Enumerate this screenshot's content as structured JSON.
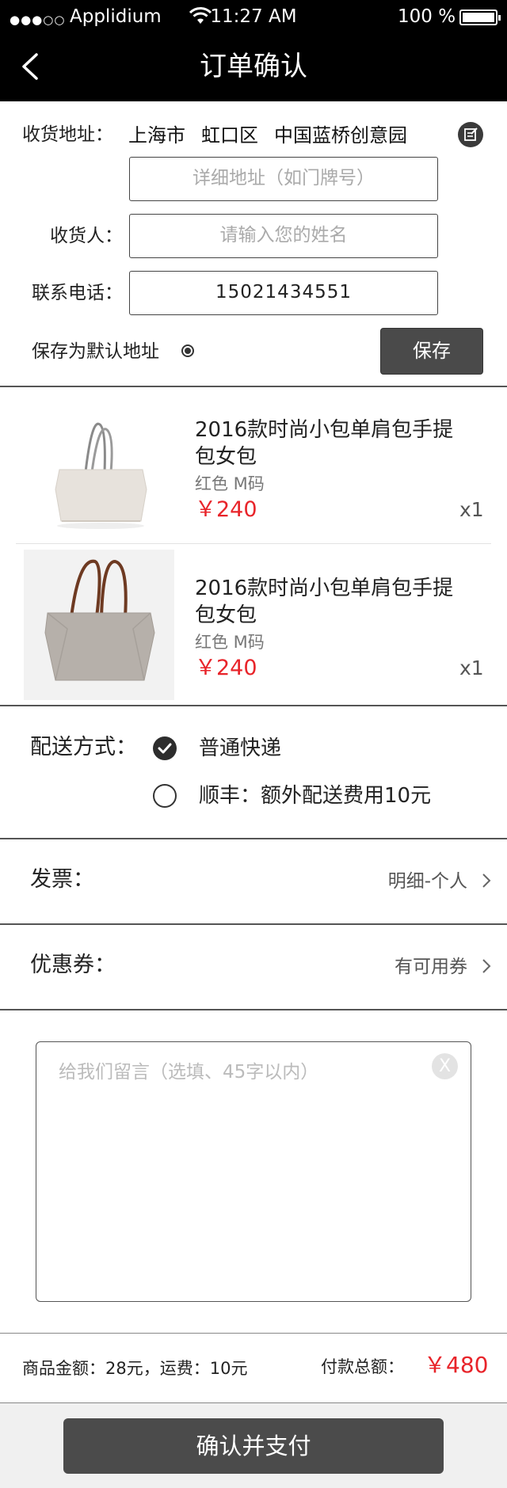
{
  "status_bar": {
    "signal": "●●●○○",
    "carrier": "Applidium",
    "time": "11:27 AM",
    "battery_text": "100 %",
    "battery_level": 1.0
  },
  "nav": {
    "title": "订单确认",
    "back_icon": "chevron-left-icon"
  },
  "address": {
    "label": "收货地址：",
    "city": "上海市",
    "district": "虹口区",
    "place": "中国蓝桥创意园",
    "edit_icon": "edit-icon",
    "detail_placeholder": "详细地址（如门牌号）",
    "receiver_label": "收货人：",
    "receiver_placeholder": "请输入您的姓名",
    "phone_label": "联系电话：",
    "phone_value": "15021434551",
    "default_label": "保存为默认地址",
    "save_label": "保存"
  },
  "products": [
    {
      "name": "2016款时尚小包单肩包手提包女包",
      "spec": "红色 M码",
      "price": "￥240",
      "qty": "x1",
      "image": "white-tote-bag"
    },
    {
      "name": "2016款时尚小包单肩包手提包女包",
      "spec": "红色 M码",
      "price": "￥240",
      "qty": "x1",
      "image": "grey-tote-bag"
    }
  ],
  "delivery": {
    "label": "配送方式：",
    "options": [
      {
        "text": "普通快递",
        "selected": true
      },
      {
        "text": "顺丰：额外配送费用10元",
        "selected": false
      }
    ]
  },
  "invoice": {
    "label": "发票：",
    "value": "明细-个人"
  },
  "coupon": {
    "label": "优惠券：",
    "value": "有可用券"
  },
  "message": {
    "placeholder": "给我们留言（选填、45字以内）",
    "clear_label": "X"
  },
  "summary": {
    "goods_text": "商品金额：28元，运费：10元",
    "total_label": "付款总额：",
    "total_value": "￥480"
  },
  "confirm_label": "确认并支付",
  "colors": {
    "price": "#e8242a",
    "button": "#4b4b4b",
    "header": "#000000"
  }
}
